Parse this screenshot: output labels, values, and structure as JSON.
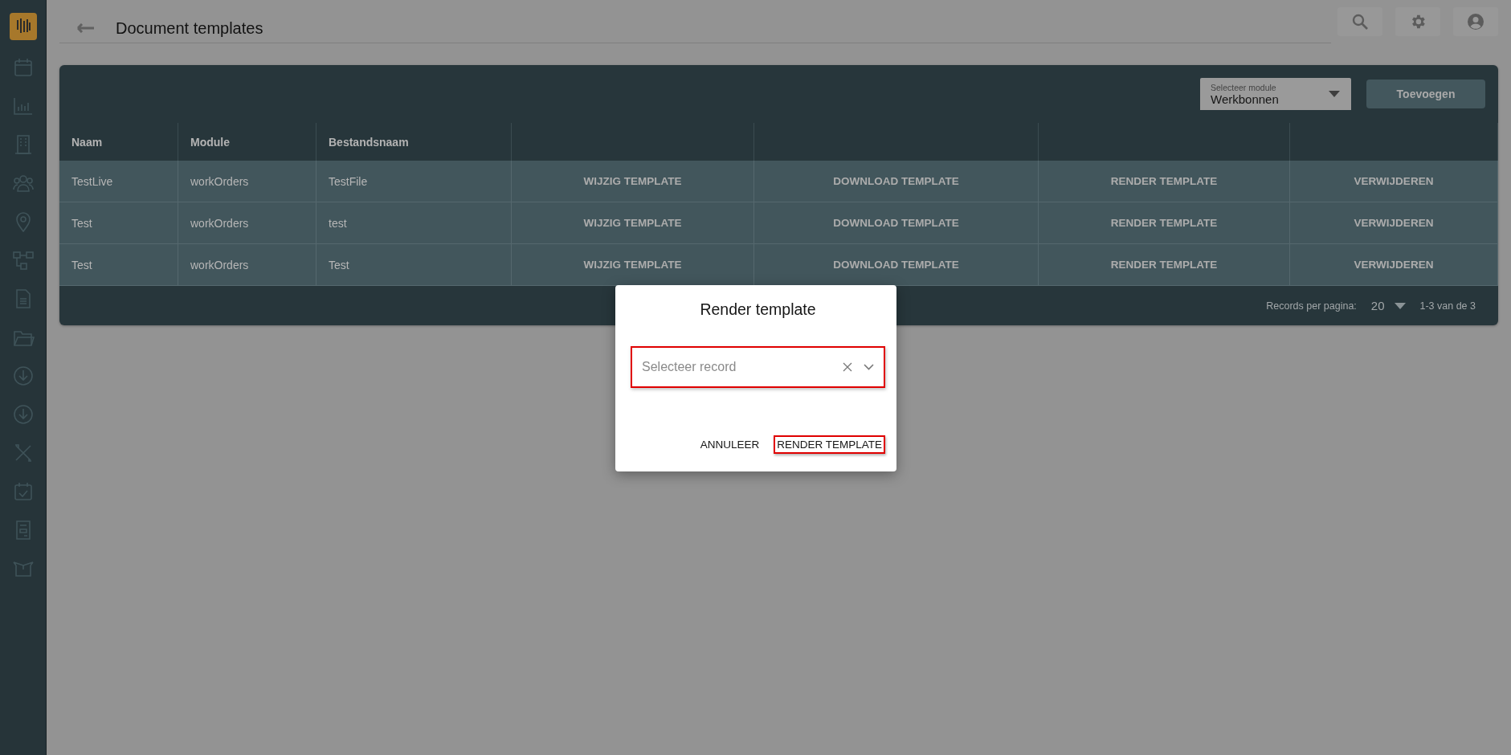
{
  "header": {
    "title": "Document templates"
  },
  "toolbar": {
    "module_select": {
      "label": "Selecteer module",
      "value": "Werkbonnen"
    },
    "add_button": "Toevoegen"
  },
  "table": {
    "columns": [
      "Naam",
      "Module",
      "Bestandsnaam"
    ],
    "rows": [
      {
        "cells": [
          "TestLive",
          "workOrders",
          "TestFile"
        ],
        "actions": [
          "WIJZIG TEMPLATE",
          "DOWNLOAD TEMPLATE",
          "RENDER TEMPLATE",
          "VERWIJDEREN"
        ]
      },
      {
        "cells": [
          "Test",
          "workOrders",
          "test"
        ],
        "actions": [
          "WIJZIG TEMPLATE",
          "DOWNLOAD TEMPLATE",
          "RENDER TEMPLATE",
          "VERWIJDEREN"
        ]
      },
      {
        "cells": [
          "Test",
          "workOrders",
          "Test"
        ],
        "actions": [
          "WIJZIG TEMPLATE",
          "DOWNLOAD TEMPLATE",
          "RENDER TEMPLATE",
          "VERWIJDEREN"
        ]
      }
    ]
  },
  "pagination": {
    "label": "Records per pagina:",
    "per_page": "20",
    "range": "1-3 van de 3"
  },
  "dialog": {
    "title": "Render template",
    "field": {
      "placeholder": "Selecteer record",
      "highlighted": true
    },
    "buttons": [
      {
        "label": "ANNULEER",
        "highlighted": false
      },
      {
        "label": "RENDER TEMPLATE",
        "highlighted": true
      }
    ]
  }
}
